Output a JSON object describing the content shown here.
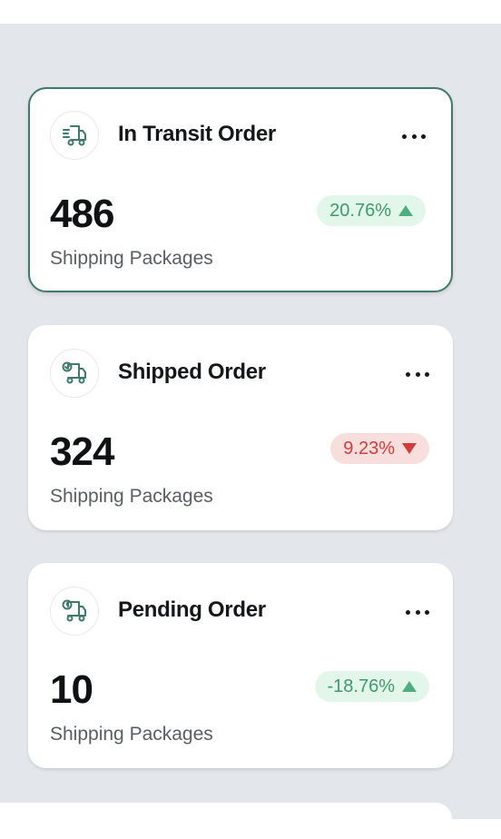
{
  "colors": {
    "accent": "#3f7a6a",
    "panel_bg": "#e3e6ea",
    "positive": "#3f9b6c",
    "positive_bg": "#e3f6ea",
    "negative": "#d23c3c",
    "negative_bg": "#f9dede"
  },
  "cards": [
    {
      "icon": "truck-fast-icon",
      "title": "In Transit Order",
      "value": "486",
      "subtitle": "Shipping Packages",
      "change": "20.76%",
      "trend": "up",
      "selected": true
    },
    {
      "icon": "truck-tick-icon",
      "title": "Shipped Order",
      "value": "324",
      "subtitle": "Shipping Packages",
      "change": "9.23%",
      "trend": "down",
      "selected": false
    },
    {
      "icon": "truck-time-icon",
      "title": "Pending Order",
      "value": "10",
      "subtitle": "Shipping Packages",
      "change": "-18.76%",
      "trend": "up",
      "selected": false
    }
  ]
}
